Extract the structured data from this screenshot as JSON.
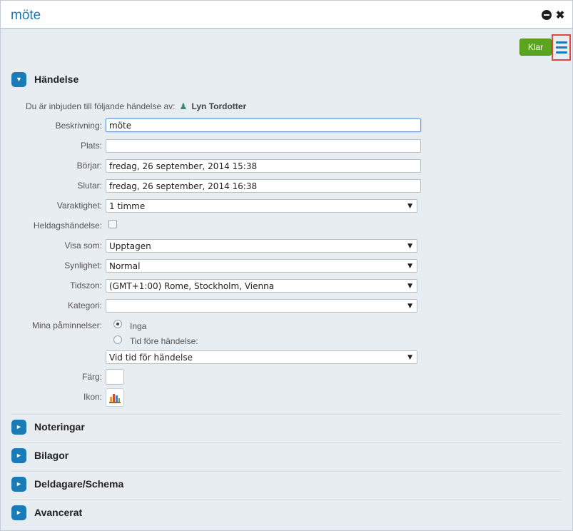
{
  "window": {
    "title": "möte"
  },
  "toolbar": {
    "done_label": "Klar",
    "menu_icon": "hamburger-menu-icon"
  },
  "sections": {
    "event": {
      "title": "Händelse"
    },
    "notes": {
      "title": "Noteringar"
    },
    "attachments": {
      "title": "Bilagor"
    },
    "participants": {
      "title": "Deldagare/Schema"
    },
    "advanced": {
      "title": "Avancerat"
    }
  },
  "invite": {
    "text": "Du är inbjuden till följande händelse av:",
    "organizer": "Lyn Tordotter"
  },
  "form": {
    "description_label": "Beskrivning:",
    "description_value": "möte",
    "location_label": "Plats:",
    "location_value": "",
    "start_label": "Börjar:",
    "start_value": "fredag, 26 september, 2014 15:38",
    "end_label": "Slutar:",
    "end_value": "fredag, 26 september, 2014 16:38",
    "duration_label": "Varaktighet:",
    "duration_value": "1 timme",
    "allday_label": "Heldagshändelse:",
    "showas_label": "Visa som:",
    "showas_value": "Upptagen",
    "visibility_label": "Synlighet:",
    "visibility_value": "Normal",
    "timezone_label": "Tidszon:",
    "timezone_value": "(GMT+1:00) Rome, Stockholm, Vienna",
    "category_label": "Kategori:",
    "category_value": "",
    "reminders_label": "Mina påminnelser:",
    "reminder_none": "Inga",
    "reminder_before": "Tid före händelse:",
    "reminder_select_value": "Vid tid för händelse",
    "color_label": "Färg:",
    "icon_label": "Ikon:"
  }
}
